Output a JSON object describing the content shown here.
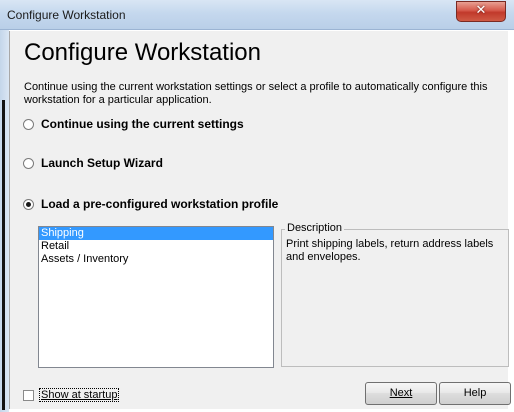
{
  "window": {
    "title": "Configure Workstation",
    "close_glyph": "✕"
  },
  "main": {
    "heading": "Configure Workstation",
    "description": "Continue using the current workstation settings or select a profile to automatically configure this workstation for a particular application.",
    "options": [
      {
        "label": "Continue using the current settings",
        "selected": false
      },
      {
        "label": "Launch Setup Wizard",
        "selected": false
      },
      {
        "label": "Load a pre-configured workstation profile",
        "selected": true
      }
    ],
    "profiles": [
      {
        "label": "Shipping",
        "selected": true
      },
      {
        "label": "Retail",
        "selected": false
      },
      {
        "label": "Assets / Inventory",
        "selected": false
      }
    ],
    "description_group": {
      "legend": "Description",
      "text": "Print shipping labels, return address labels and envelopes."
    }
  },
  "footer": {
    "show_at_startup_label": "Show at startup",
    "show_at_startup_checked": false,
    "next_label": "Next",
    "help_label": "Help"
  },
  "colors": {
    "selection": "#3399ff",
    "dialog_bg": "#f0f0f0"
  }
}
